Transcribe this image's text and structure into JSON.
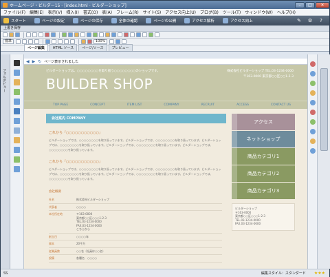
{
  "window": {
    "title": "ホームページ・ビルダー15 - [index.html - ビルダーショップ]"
  },
  "menu": [
    "ファイル(F)",
    "編集(E)",
    "表示(V)",
    "挿入(I)",
    "書式(O)",
    "表(A)",
    "フレーム(R)",
    "サイト(S)",
    "アクセス向上(U)",
    "ブログ(B)",
    "ツール(T)",
    "ウィンドウ(W)",
    "ヘルプ(H)"
  ],
  "quickbar": [
    {
      "label": "スタート",
      "color": "#f0c040"
    },
    {
      "label": "ページの設定",
      "color": "#8fb0d8"
    },
    {
      "label": "ページの保存",
      "color": "#8fb0d8"
    },
    {
      "label": "全体の確認",
      "color": "#8fb0d8"
    },
    {
      "label": "ページの公開",
      "color": "#8fb0d8"
    },
    {
      "label": "アクセス解析",
      "color": "#8fb0d8"
    },
    {
      "label": "アクセス向上",
      "color": "#8fb0d8"
    }
  ],
  "savebar": "上書き保存",
  "toolbar": {
    "style_select": "標準",
    "zoom_select": "100%"
  },
  "tabs": [
    "ページ編集",
    "HTML ソース",
    "ページ/ソース",
    "プレビュー"
  ],
  "address": "ページ表示されました",
  "left_panel_label": "フォルダビュー",
  "site": {
    "tagline": "ビルダーショップは、○○○○○○○○を取り扱う○○○○○○○○のショップです。",
    "logo": "BUILDER SHOP",
    "contact_line1": "株式会社ビルダーショップ   TEL.03-1234-0000",
    "contact_line2": "〒163-0000 東京都○○区○○1-2-3",
    "nav": [
      "TOP PAGE",
      "CONCEPT",
      "ITEM LIST",
      "COMPANY",
      "RECRUIT",
      "ACCESS",
      "CONTACT US"
    ]
  },
  "main": {
    "section_title": "会社案内   COMPANY",
    "subhead1": "これから『○○○○○○○○○○○』",
    "para1": "ビルダーショップでは、○○○○○○○○を取り扱っています。ビルダーショップでは、○○○○○○○○を取り扱っています。ビルダーショップでは、○○○○○○○○を取り扱っています。ビルダーショップでは、○○○○○○○○を取り扱っています。ビルダーショップでは、○○○○○○○○を取り扱っています。",
    "subhead2": "これから『○○○○○○○○○○○』",
    "para2": "ビルダーショップでは、○○○○○○○○を取り扱っています。ビルダーショップでは、○○○○○○○○を取り扱っています。ビルダーショップでは、○○○○○○○○を取り扱っています。ビルダーショップでは、○○○○○○○○を取り扱っています。ビルダーショップでは、○○○○○○○○を取り扱っています。",
    "info_title": "会社概要",
    "info_rows": [
      {
        "k": "社名",
        "v": "株式会社ビルダーショップ"
      },
      {
        "k": "代表者",
        "v": "○○○○"
      },
      {
        "k": "本社所在地",
        "v": "〒163-0000\n東京都○○区○○○1-2-3\nTEL.03-1234-0000\nFAX.03-1234-0000\nこちらから"
      },
      {
        "k": "創立日",
        "v": "○○○○年"
      },
      {
        "k": "資本",
        "v": "20千万"
      },
      {
        "k": "従業員数",
        "v": "○○名（社員は○○名）"
      },
      {
        "k": "設備",
        "v": "各種名　○○○○"
      }
    ]
  },
  "side": {
    "buttons": [
      {
        "label": "アクセス",
        "color": "#a8919a"
      },
      {
        "label": "ネットショップ",
        "color": "#6e8c9c"
      },
      {
        "label": "商品カテゴリ1",
        "color": "#8a9a62"
      },
      {
        "label": "商品カテゴリ2",
        "color": "#8a9a62"
      },
      {
        "label": "商品カテゴリ3",
        "color": "#8a9a62"
      }
    ],
    "box": "ビルダーショップ\n〒163-0000\n東京都○○区○○○1-2-3\nTEL.03-1234-0000\nFAX.03-1234-0000"
  },
  "status": {
    "left": "SS",
    "style": "編集スタイル：スタンダード"
  }
}
